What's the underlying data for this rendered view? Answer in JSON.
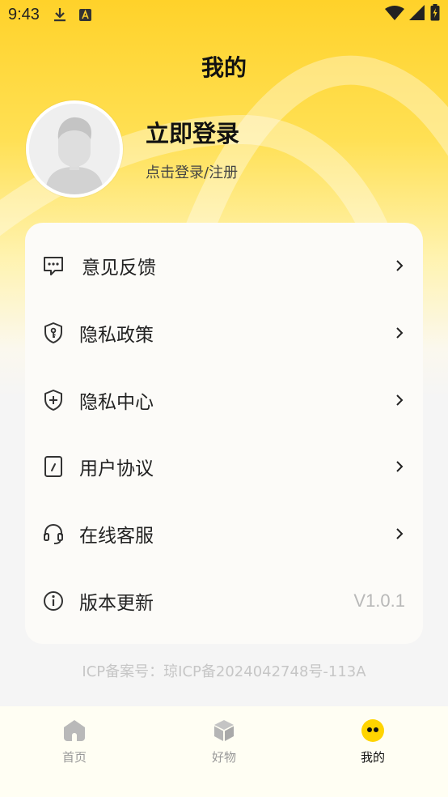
{
  "status_bar": {
    "time": "9:43"
  },
  "header": {
    "title": "我的"
  },
  "profile": {
    "login_title": "立即登录",
    "login_subtitle": "点击登录/注册"
  },
  "menu": {
    "items": [
      {
        "label": "意见反馈",
        "icon": "feedback-chat-icon",
        "trailing": "chevron"
      },
      {
        "label": "隐私政策",
        "icon": "shield-key-icon",
        "trailing": "chevron"
      },
      {
        "label": "隐私中心",
        "icon": "shield-plus-icon",
        "trailing": "chevron"
      },
      {
        "label": "用户协议",
        "icon": "document-edit-icon",
        "trailing": "chevron"
      },
      {
        "label": "在线客服",
        "icon": "headset-icon",
        "trailing": "chevron"
      },
      {
        "label": "版本更新",
        "icon": "info-icon",
        "trailing": "value",
        "value": "V1.0.1"
      }
    ]
  },
  "footer": {
    "icp": "ICP备案号：琼ICP备2024042748号-113A"
  },
  "tab_bar": {
    "tabs": [
      {
        "label": "首页",
        "icon": "home-icon",
        "active": false
      },
      {
        "label": "好物",
        "icon": "cube-icon",
        "active": false
      },
      {
        "label": "我的",
        "icon": "profile-face-icon",
        "active": true
      }
    ]
  },
  "colors": {
    "header_yellow": "#ffd22a",
    "card_bg": "#fcfbf8",
    "page_bg": "#f5f5f5",
    "active_tab_icon": "#ffd400",
    "inactive_text": "#999999",
    "version_text": "#b8b8b8"
  }
}
